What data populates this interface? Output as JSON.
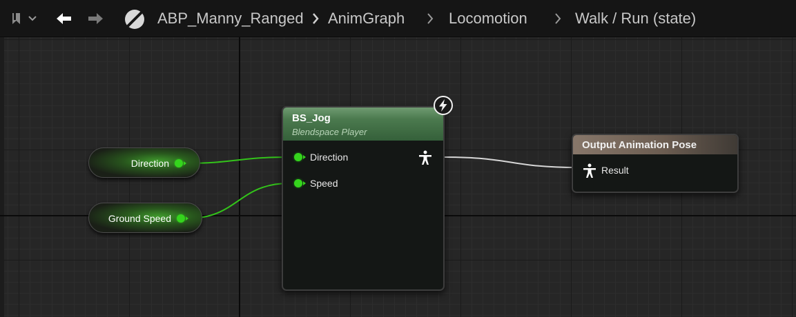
{
  "breadcrumb": {
    "items": [
      "ABP_Manny_Ranged",
      "AnimGraph",
      "Locomotion",
      "Walk / Run (state)"
    ]
  },
  "icons": {
    "bookmark": "bookmark-icon",
    "dropdown": "chevron-down-icon",
    "back": "arrow-left-icon",
    "forward": "arrow-right-icon",
    "asset": "slashed-circle-icon",
    "pose": "pose-figure-icon",
    "fast_path": "lightning-icon"
  },
  "variables": [
    {
      "label": "Direction"
    },
    {
      "label": "Ground Speed"
    }
  ],
  "blendspace_node": {
    "title": "BS_Jog",
    "subtitle": "Blendspace Player",
    "inputs": [
      "Direction",
      "Speed"
    ]
  },
  "output_node": {
    "title": "Output Animation Pose",
    "input": "Result"
  },
  "colors": {
    "float_pin": "#35d41d",
    "pose_wire": "#d8d8d8",
    "blendspace_header": "#4b7a4e",
    "output_header": "#87776a"
  }
}
